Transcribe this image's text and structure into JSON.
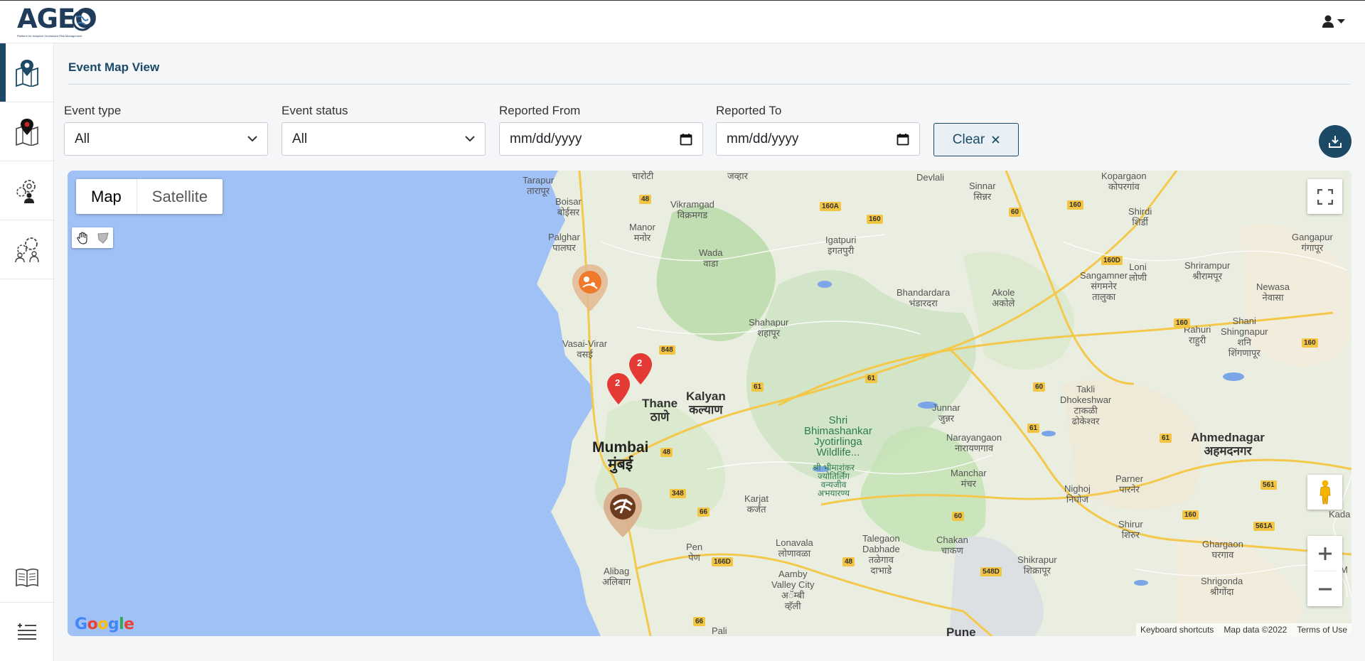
{
  "app": {
    "logo_text": "AGEO",
    "logo_tagline": "Platform for Adaptive Geohazard Risk Management"
  },
  "sidebar": {
    "items": [
      {
        "icon": "map-pin-icon",
        "active": true
      },
      {
        "icon": "location-map-icon",
        "active": false
      },
      {
        "icon": "user-gears-icon",
        "active": false
      },
      {
        "icon": "users-gears-icon",
        "active": false
      }
    ],
    "bottom": [
      {
        "icon": "book-icon"
      },
      {
        "icon": "menu-toggle-icon"
      }
    ]
  },
  "page": {
    "title": "Event Map View"
  },
  "filters": {
    "event_type": {
      "label": "Event type",
      "value": "All"
    },
    "event_status": {
      "label": "Event status",
      "value": "All"
    },
    "reported_from": {
      "label": "Reported From",
      "placeholder": "mm/dd/yyyy"
    },
    "reported_to": {
      "label": "Reported To",
      "placeholder": "mm/dd/yyyy"
    },
    "clear_label": "Clear"
  },
  "map": {
    "type_map": "Map",
    "type_satellite": "Satellite",
    "google": "Google",
    "attribution": {
      "shortcuts": "Keyboard shortcuts",
      "data": "Map data ©2022",
      "terms": "Terms of Use"
    },
    "cluster_counts": [
      "2",
      "2"
    ],
    "places": [
      {
        "name": "Tarapur\nतारापूर"
      },
      {
        "name": "Boisar\nबोईसर"
      },
      {
        "name": "Palghar\nपालघर"
      },
      {
        "name": "Manor\nमनोर"
      },
      {
        "name": "Vikramgad\nविक्रमगड"
      },
      {
        "name": "Wada\nवाडा"
      },
      {
        "name": "Vasai-Virar\nवसई"
      },
      {
        "name": "Thane\nठाणे"
      },
      {
        "name": "Kalyan\nकल्याण"
      },
      {
        "name": "Mumbai\nमुंबई"
      },
      {
        "name": "Shahapur\nशहापूर"
      },
      {
        "name": "Igatpuri\nइगतपुरी"
      },
      {
        "name": "Bhandardara\nभंडारदरा"
      },
      {
        "name": "Akole\nअकोले"
      },
      {
        "name": "Sinnar\nसिन्नर"
      },
      {
        "name": "Devlali"
      },
      {
        "name": "Kopargaon\nकोपरगांव"
      },
      {
        "name": "Shirdi\nशिर्डी"
      },
      {
        "name": "Sangamner\nसंगमनेर\nतालुका"
      },
      {
        "name": "Loni\nलोणी"
      },
      {
        "name": "Shrirampur\nश्रीरामपूर"
      },
      {
        "name": "Newasa\nनेवासा"
      },
      {
        "name": "Gangapur\nगंगापूर"
      },
      {
        "name": "Rahuri\nराहुरी"
      },
      {
        "name": "Shani\nShingnapur\nशनि\nशिंगणापूर"
      },
      {
        "name": "Junnar\nजुन्नर"
      },
      {
        "name": "Narayangaon\nनारायणगाव"
      },
      {
        "name": "Takli\nDhokeshwar\nटाकळी\nढोकेश्वर"
      },
      {
        "name": "Ahmednagar\nअहमदनगर"
      },
      {
        "name": "Shri\nBhimashankar\nJyotirlinga\nWildlife..."
      },
      {
        "name": "श्री भीमाशंकर\nज्योतिर्लिंग\nवन्यजीव\nअभयारण्य"
      },
      {
        "name": "Manchar\nमंचर"
      },
      {
        "name": "Nighoj\nनिघोज"
      },
      {
        "name": "Parner\nपारनेर"
      },
      {
        "name": "Karjat\nकर्जत"
      },
      {
        "name": "Lonavala\nलोणावळा"
      },
      {
        "name": "Talegaon\nDabhade\nतळेगाव\nदाभाडे"
      },
      {
        "name": "Chakan\nचाकण"
      },
      {
        "name": "Shikrapur\nशिक्रापूर"
      },
      {
        "name": "Shirur\nशिरुर"
      },
      {
        "name": "Ghargaon\nघरगाव"
      },
      {
        "name": "Shrigonda\nश्रीगोंदा"
      },
      {
        "name": "Pen\nपेण"
      },
      {
        "name": "Alibag\nअलिबाग"
      },
      {
        "name": "Aamby\nValley City\nअॅम्बी\nव्हॅली"
      },
      {
        "name": "जव्हार"
      },
      {
        "name": "चारोटी"
      },
      {
        "name": "Kada"
      },
      {
        "name": "M"
      },
      {
        "name": "Pali"
      },
      {
        "name": "Pune"
      }
    ],
    "shields": [
      "48",
      "160A",
      "160",
      "60",
      "160",
      "160D",
      "160",
      "848",
      "61",
      "61",
      "60",
      "61",
      "61",
      "48",
      "348",
      "66",
      "166D",
      "48",
      "548D",
      "60",
      "160",
      "561",
      "561A",
      "66",
      "160"
    ]
  }
}
